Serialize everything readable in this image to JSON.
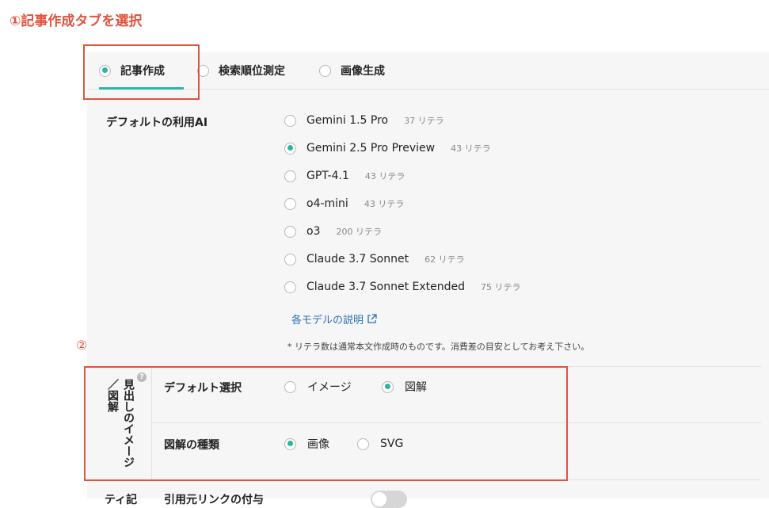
{
  "annotations": {
    "step1": "①記事作成タブを選択",
    "step2": "②"
  },
  "tabs": [
    {
      "label": "記事作成",
      "selected": true
    },
    {
      "label": "検索順位測定",
      "selected": false
    },
    {
      "label": "画像生成",
      "selected": false
    }
  ],
  "default_ai": {
    "label": "デフォルトの利用AI",
    "models": [
      {
        "name": "Gemini 1.5 Pro",
        "credits": "37",
        "selected": false
      },
      {
        "name": "Gemini 2.5 Pro Preview",
        "credits": "43",
        "selected": true
      },
      {
        "name": "GPT-4.1",
        "credits": "43",
        "selected": false
      },
      {
        "name": "o4-mini",
        "credits": "43",
        "selected": false
      },
      {
        "name": "o3",
        "credits": "200",
        "selected": false
      },
      {
        "name": "Claude 3.7 Sonnet",
        "credits": "62",
        "selected": false
      },
      {
        "name": "Claude 3.7 Sonnet Extended",
        "credits": "75",
        "selected": false
      }
    ],
    "credit_unit": "リテラ",
    "model_description_link": "各モデルの説明",
    "credit_note": "* リテラ数は通常本文作成時のものです。消費差の目安としてお考え下さい。"
  },
  "heading_image": {
    "label": "見出しのイメージ／図解",
    "help_icon": "?",
    "default_select": {
      "label": "デフォルト選択",
      "options": [
        {
          "label": "イメージ",
          "selected": false
        },
        {
          "label": "図解",
          "selected": true
        }
      ]
    },
    "diagram_type": {
      "label": "図解の種類",
      "options": [
        {
          "label": "画像",
          "selected": true
        },
        {
          "label": "SVG",
          "selected": false
        }
      ]
    }
  },
  "cutoff": {
    "label_a": "ティ記",
    "label_b": "引用元リンクの付与"
  },
  "colors": {
    "accent": "#2bb5a4",
    "annotation": "#e0533d",
    "link": "#2a6fb3"
  }
}
